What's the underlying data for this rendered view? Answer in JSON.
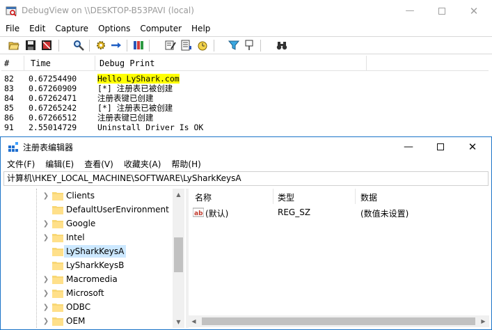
{
  "debugview": {
    "title": "DebugView on \\\\DESKTOP-B53PAVI (local)",
    "menu": [
      "File",
      "Edit",
      "Capture",
      "Options",
      "Computer",
      "Help"
    ],
    "columns": {
      "num": "#",
      "time": "Time",
      "print": "Debug Print"
    },
    "rows": [
      {
        "num": "82",
        "time": "0.67254490",
        "text": "Hello LyShark.com",
        "highlight": true
      },
      {
        "num": "83",
        "time": "0.67260909",
        "text": "[*] 注册表已被创建",
        "highlight": false
      },
      {
        "num": "84",
        "time": "0.67262471",
        "text": "注册表键已创建",
        "highlight": false
      },
      {
        "num": "85",
        "time": "0.67265242",
        "text": "[*] 注册表已被创建",
        "highlight": false
      },
      {
        "num": "86",
        "time": "0.67266512",
        "text": "注册表键已创建",
        "highlight": false
      },
      {
        "num": "91",
        "time": "2.55014729",
        "text": "Uninstall Driver Is OK",
        "highlight": false
      }
    ],
    "toolbar_icons": [
      "open-icon",
      "save-icon",
      "clear-icon",
      "find-icon",
      "capture-gear-icon",
      "autoscroll-arrow-icon",
      "history-depth-icon",
      "filter-edit-icon",
      "log-file-icon",
      "clock-icon",
      "highlight-filter-icon",
      "pin-icon",
      "binoculars-icon"
    ],
    "highlight_color": "#ffff00"
  },
  "regedit": {
    "title": "注册表编辑器",
    "menu": [
      "文件(F)",
      "编辑(E)",
      "查看(V)",
      "收藏夹(A)",
      "帮助(H)"
    ],
    "address": "计算机\\HKEY_LOCAL_MACHINE\\SOFTWARE\\LySharkKeysA",
    "tree": [
      {
        "label": "Clients",
        "selected": false
      },
      {
        "label": "DefaultUserEnvironment",
        "selected": false
      },
      {
        "label": "Google",
        "selected": false
      },
      {
        "label": "Intel",
        "selected": false
      },
      {
        "label": "LySharkKeysA",
        "selected": true
      },
      {
        "label": "LySharkKeysB",
        "selected": false
      },
      {
        "label": "Macromedia",
        "selected": false
      },
      {
        "label": "Microsoft",
        "selected": false
      },
      {
        "label": "ODBC",
        "selected": false
      },
      {
        "label": "OEM",
        "selected": false
      }
    ],
    "list_headers": {
      "name": "名称",
      "type": "类型",
      "data": "数据"
    },
    "values": [
      {
        "name": "(默认)",
        "type": "REG_SZ",
        "data": "(数值未设置)"
      }
    ],
    "selection_color": "#cce8ff",
    "accent": "#1a73c8"
  }
}
